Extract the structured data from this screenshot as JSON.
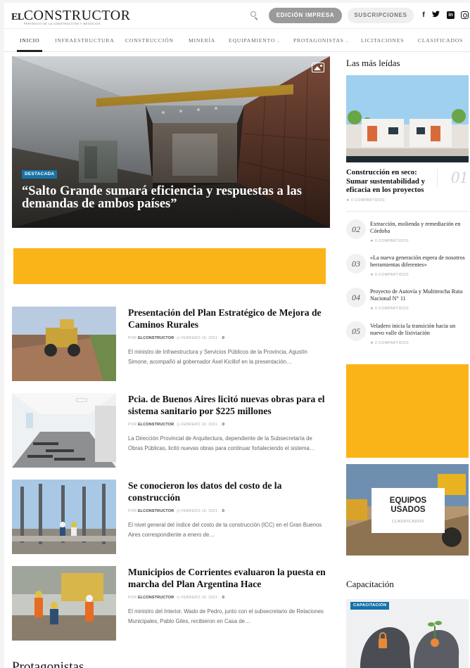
{
  "header": {
    "logo_el": "EL",
    "logo_brand": "CONSTRUCTOR",
    "logo_tagline": "PERIÓDICO DE LA CONSTRUCCIÓN Y NEGOCIOS",
    "print_label": "EDICIÓN IMPRESA",
    "subs_label": "SUSCRIPCIONES",
    "social": {
      "facebook": "f",
      "linkedin": "in"
    }
  },
  "nav": {
    "items": [
      {
        "label": "INICIO"
      },
      {
        "label": "INFRAESTRUCTURA"
      },
      {
        "label": "CONSTRUCCIÓN"
      },
      {
        "label": "MINERÍA"
      },
      {
        "label": "EQUIPAMIENTO"
      },
      {
        "label": "PROTAGONISTAS"
      },
      {
        "label": "LICITACIONES"
      },
      {
        "label": "CLASIFICADOS"
      }
    ]
  },
  "featured": {
    "badge": "DESTACADA",
    "title": "“Salto Grande sumará eficiencia y respuestas a las demandas de ambos países”"
  },
  "posts": [
    {
      "title": "Presentación del Plan Estratégico de Mejora de Caminos Rurales",
      "meta_prefix": "POR ",
      "author": "ELCONSTRUCTOR",
      "date": "◷ FEBRERO 19, 2021",
      "comments": "0",
      "excerpt": "El ministro de Infraestructura y Servicios Públicos de la Provincia, Agustín Simone, acompañó al gobernador Axel Kicillof en la presentación…"
    },
    {
      "title": "Pcia. de Buenos Aires licitó nuevas obras para el sistema sanitario por $225 millones",
      "meta_prefix": "POR ",
      "author": "ELCONSTRUCTOR",
      "date": "◷ FEBRERO 19, 2021",
      "comments": "0",
      "excerpt": "La Dirección Provincial de Arquitectura, dependiente de la Subsecretaría de Obras Públicas, licitó nuevas obras para continuar fortaleciendo el sistema…"
    },
    {
      "title": "Se conocieron los datos del costo de la construcción",
      "meta_prefix": "POR ",
      "author": "ELCONSTRUCTOR",
      "date": "◷ FEBRERO 19, 2021",
      "comments": "0",
      "excerpt": "El nivel general del índice del costo de la construcción (ICC) en el Gran Buenos Aires correspondiente a enero de…"
    },
    {
      "title": "Municipios de Corrientes evaluaron la puesta en marcha del Plan Argentina Hace",
      "meta_prefix": "POR ",
      "author": "ELCONSTRUCTOR",
      "date": "◷ FEBRERO 19, 2021",
      "comments": "0",
      "excerpt": "El ministro del Interior, Wado de Pedro, junto con el subsecretario de Relaciones Municipales, Pablo Giles, recibieron en Casa de…"
    }
  ],
  "bottom_section_title": "Protagonistas",
  "sidebar": {
    "most_read_title": "Las más leídas",
    "top": {
      "number": "01",
      "title": "Construcción en seco: Sumar sustentabilidad y eficacia en los proyectos",
      "shares": "0 COMPARTIDOS"
    },
    "ranked": [
      {
        "number": "02",
        "title": "Extracción, molienda y remediación en Córdoba",
        "shares": "0 COMPARTIDOS"
      },
      {
        "number": "03",
        "title": "«La nueva generación espera de nosotros herramientas diferentes»",
        "shares": "0 COMPARTIDOS"
      },
      {
        "number": "04",
        "title": "Proyecto de Autovía y Multitrocha Ruta Nacional N° 11",
        "shares": "0 COMPARTIDOS"
      },
      {
        "number": "05",
        "title": "Veladero inicia la transición hacia un nuevo valle de lixiviación",
        "shares": "0 COMPARTIDOS"
      }
    ],
    "equipos": {
      "title": "EQUIPOS USADOS",
      "subtitle": "CLASIFICADOS"
    },
    "capacitacion_title": "Capacitación",
    "capacitacion_badge": "CAPACITACIÓN"
  },
  "colors": {
    "accent_yellow": "#fbb418",
    "badge_blue": "#1673a8"
  },
  "icons": [
    "search-icon",
    "facebook-icon",
    "twitter-icon",
    "linkedin-icon",
    "instagram-icon",
    "gallery-icon",
    "clock-icon",
    "comment-icon",
    "share-icon"
  ]
}
